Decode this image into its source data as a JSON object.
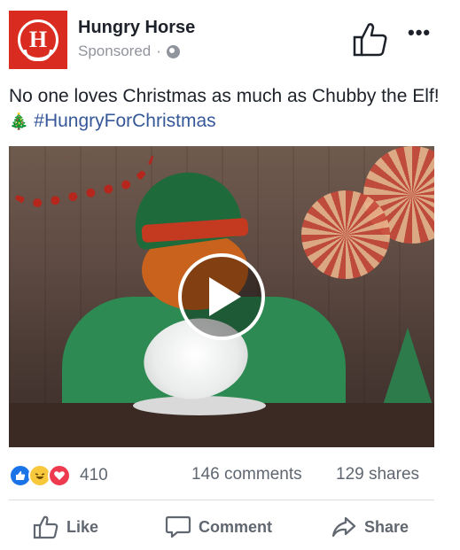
{
  "header": {
    "page_name": "Hungry Horse",
    "sponsored": "Sponsored",
    "separator": "·",
    "logo_letter": "H",
    "more": "•••"
  },
  "post": {
    "text_main": "No one loves Christmas as much as Chubby the Elf!",
    "emoji": "🎄",
    "hashtag": "#HungryForChristmas"
  },
  "stats": {
    "reaction_count": "410",
    "comments": "146 comments",
    "shares": "129 shares"
  },
  "actions": {
    "like": "Like",
    "comment": "Comment",
    "share": "Share"
  },
  "colors": {
    "brand_red": "#d92b20",
    "link_blue": "#365899",
    "muted": "#606770"
  }
}
